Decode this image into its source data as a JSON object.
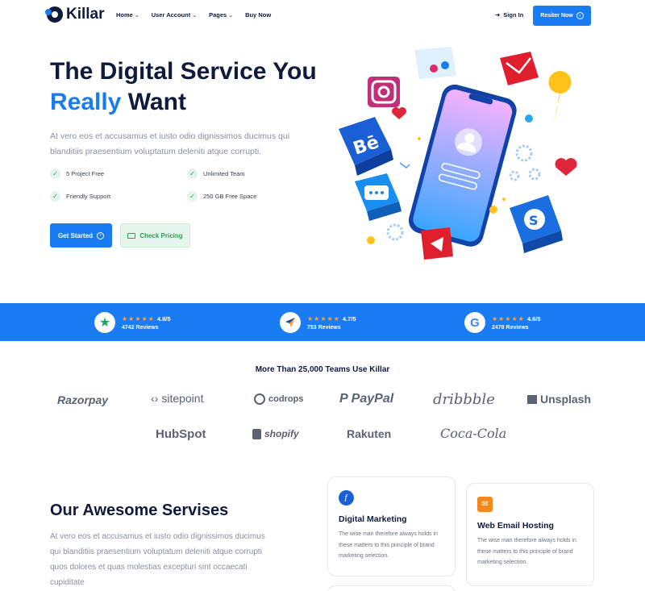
{
  "brand": {
    "name": "Killar"
  },
  "nav": {
    "items": [
      {
        "label": "Home",
        "dropdown": true
      },
      {
        "label": "User Account",
        "dropdown": true
      },
      {
        "label": "Pages",
        "dropdown": true
      },
      {
        "label": "Buy Now",
        "dropdown": false
      }
    ],
    "sign_in": "Sign In",
    "register": "Resiter Now"
  },
  "hero": {
    "title_line1": "The Digital Service You",
    "title_accent": "Really",
    "title_rest": " Want",
    "description": "At vero eos et accusamus et iusto odio dignissimos ducimus qui blanditiis praesentium voluptatum deleniti atque corrupti.",
    "features": [
      "5 Project Free",
      "Unlimited Team",
      "Friendly Support",
      "250 GB Free Space"
    ],
    "primary_button": "Get Started",
    "secondary_button": "Check Pricing"
  },
  "ratings": [
    {
      "platform": "trustpilot-icon",
      "score": "4.8/5",
      "reviews": "4742 Reviews",
      "stars": 5
    },
    {
      "platform": "capterra-icon",
      "score": "4.7/5",
      "reviews": "753 Reviews",
      "stars": 5
    },
    {
      "platform": "google-icon",
      "score": "4.6/5",
      "reviews": "2478 Reviews",
      "stars": 5
    }
  ],
  "logos": {
    "title": "More Than 25,000 Teams Use Killar",
    "brands": [
      "Razorpay",
      "sitepoint",
      "codrops",
      "PayPal",
      "dribbble",
      "Unsplash",
      "HubSpot",
      "shopify",
      "Rakuten",
      "Coca-Cola"
    ]
  },
  "services": {
    "title": "Our Awesome Servises",
    "description": "At vero eos et accusamus et iusto odio dignissimos ducimus qui blanditiis praesentium voluptatum deleniti atque corrupti quos dolores et quas molestias excepturi sint occaecati cupiditate",
    "cards": [
      {
        "icon": "fedora-icon",
        "title": "Digital Marketing",
        "text": "The wise man therefore always holds in these matters to this principle of brand marketing selection."
      },
      {
        "icon": "email-icon",
        "title": "Web Email Hosting",
        "text": "The wise man therefore always holds in these matters to this principle of brand marketing selection."
      }
    ]
  },
  "colors": {
    "primary": "#1a7cf3",
    "dark": "#0f1b3d",
    "muted": "#8a90a0",
    "star": "#ff9d3c",
    "success": "#2a9d5a"
  }
}
